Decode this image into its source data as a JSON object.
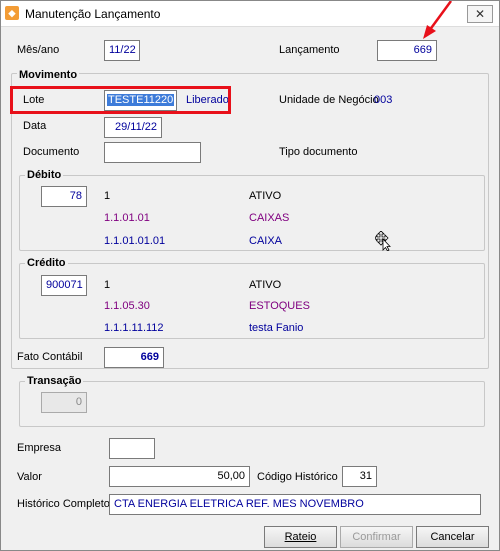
{
  "window": {
    "title": "Manutenção Lançamento",
    "close_label": "✕"
  },
  "header": {
    "mes_ano_label": "Mês/ano",
    "mes_ano_value": "11/22",
    "lancamento_label": "Lançamento",
    "lancamento_value": "669"
  },
  "movimento": {
    "title": "Movimento",
    "lote_label": "Lote",
    "lote_value": "TESTE11220",
    "lote_status": "Liberado",
    "unidade_label": "Unidade de Negócio",
    "unidade_value": "003",
    "data_label": "Data",
    "data_value": "29/11/22",
    "documento_label": "Documento",
    "documento_value": "",
    "tipo_documento_label": "Tipo documento"
  },
  "debito": {
    "title": "Débito",
    "code": "78",
    "level": "1",
    "name": "ATIVO",
    "rows": [
      {
        "account": "1.1.01.01",
        "desc": "CAIXAS"
      },
      {
        "account": "1.1.01.01.01",
        "desc": "CAIXA"
      }
    ]
  },
  "credito": {
    "title": "Crédito",
    "code": "900071",
    "level": "1",
    "name": "ATIVO",
    "rows": [
      {
        "account": "1.1.05.30",
        "desc": "ESTOQUES"
      },
      {
        "account": "1.1.1.11.112",
        "desc": "testa Fanio"
      }
    ]
  },
  "fato_contabil": {
    "label": "Fato Contábil",
    "value": "669"
  },
  "transacao": {
    "title": "Transação",
    "value": "0"
  },
  "empresa": {
    "label": "Empresa",
    "value": ""
  },
  "valor": {
    "label": "Valor",
    "value": "50,00"
  },
  "codigo_historico": {
    "label": "Código Histórico",
    "value": "31"
  },
  "historico_completo": {
    "label": "Histórico Completo",
    "value": "CTA ENERGIA ELETRICA REF. MES NOVEMBRO"
  },
  "buttons": {
    "rateio": "Rateio",
    "confirmar": "Confirmar",
    "cancelar": "Cancelar"
  },
  "colors": {
    "highlight": "#e8101a",
    "accent": "#00009c",
    "account": "#800080"
  }
}
